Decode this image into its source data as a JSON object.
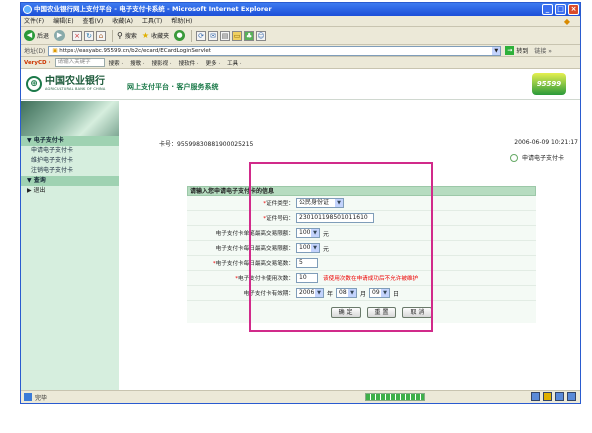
{
  "window": {
    "title": "中国农业银行网上支付平台 - 电子支付卡系统 - Microsoft Internet Explorer",
    "buttons": {
      "minimize": "_",
      "maximize": "□",
      "close": "×"
    }
  },
  "menu": [
    "文件(F)",
    "编辑(E)",
    "查看(V)",
    "收藏(A)",
    "工具(T)",
    "帮助(H)"
  ],
  "toolbar": {
    "back": "后退",
    "search": "搜索",
    "favorites": "收藏夹"
  },
  "address": {
    "label": "地址(D)",
    "url": "https://easyabc.95599.cn/b2c/ecard/ECardLoginServlet",
    "go": "转到",
    "links": "链接 »"
  },
  "linkbar": {
    "brand": "VeryCD ·",
    "search_placeholder": "请输入关键字",
    "items": [
      "搜索 ·",
      "搜歌 ·",
      "搜影视 ·",
      "搜软件 ·",
      "更多 ·",
      "工具 ·"
    ]
  },
  "header": {
    "logo_cn": "中国农业银行",
    "logo_en": "AGRICULTURAL BANK OF CHINA",
    "title": "网上支付平台 · 客户服务系统",
    "brand": "95599"
  },
  "sidebar": {
    "items": [
      {
        "label": "▼ 电子支付卡",
        "kind": "head"
      },
      {
        "label": "申请电子支付卡",
        "kind": "sub"
      },
      {
        "label": "维护电子支付卡",
        "kind": "sub"
      },
      {
        "label": "注销电子支付卡",
        "kind": "sub"
      },
      {
        "label": "▼ 查询",
        "kind": "head"
      },
      {
        "label": "▶ 退出",
        "kind": "head2"
      }
    ]
  },
  "main": {
    "card_number": "卡号：95599830881900025215",
    "datetime": "2006-06-09 10:21:17",
    "apply_link": "申请电子支付卡",
    "form": {
      "heading": "请输入您申请电子支付卡的信息",
      "id_type_label": "证件类型：",
      "id_type_value": "公民身份证",
      "id_number_label": "证件号码：",
      "id_number_value": "230101198501011610",
      "single_limit_label": "电子支付卡单笔最高交易限额：",
      "single_limit_value": "100",
      "single_limit_unit": "元",
      "daily_limit_label": "电子支付卡每日最高交易限额：",
      "daily_limit_value": "100",
      "daily_limit_unit": "元",
      "daily_count_label": "电子支付卡每日最高交易笔数：",
      "daily_count_value": "5",
      "uses_label": "电子支付卡使用次数：",
      "uses_value": "10",
      "uses_hint": "该使用次数在申请成功后不允许被维护",
      "expiry_label": "电子支付卡有效期：",
      "expiry_year": "2006",
      "expiry_year_unit": "年",
      "expiry_month": "08",
      "expiry_month_unit": "月",
      "expiry_day": "09",
      "expiry_day_unit": "日",
      "buttons": {
        "confirm": "确 定",
        "reset": "重 置",
        "cancel": "取 消"
      }
    }
  },
  "status": {
    "text": "完毕",
    "progress": 1.0
  },
  "colors": {
    "sidebar_bg": "#d6eede",
    "highlight_box": "#d12a8a",
    "required": "#ee0000"
  }
}
